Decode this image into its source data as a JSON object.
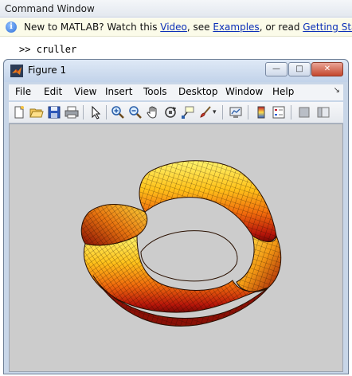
{
  "command_window": {
    "title": "Command Window",
    "info_prefix": "New to MATLAB? Watch this ",
    "link_video": "Video",
    "info_mid1": ", see ",
    "link_examples": "Examples",
    "info_mid2": ", or read ",
    "link_getting_started": "Getting Started",
    "info_suffix": ".",
    "prompt": ">>",
    "command": "cruller"
  },
  "figure": {
    "title": "Figure 1",
    "menu": [
      "File",
      "Edit",
      "View",
      "Insert",
      "Tools",
      "Desktop",
      "Window",
      "Help"
    ],
    "toolbar_icons": [
      "new-figure-icon",
      "open-file-icon",
      "save-icon",
      "print-icon",
      "select-arrow-icon",
      "zoom-in-icon",
      "zoom-out-icon",
      "pan-hand-icon",
      "rotate-3d-icon",
      "data-cursor-icon",
      "brush-icon",
      "brush-dropdown-icon",
      "link-plot-icon",
      "colorbar-icon",
      "legend-icon",
      "hide-plot-tools-icon",
      "show-plot-tools-icon"
    ],
    "plot": {
      "description_colormap": "hot",
      "background_color": "#cccccc"
    }
  },
  "colors": {
    "link": "#0b2fb8",
    "info_bg": "#fbfbe9",
    "plot_bg": "#cccccc"
  }
}
